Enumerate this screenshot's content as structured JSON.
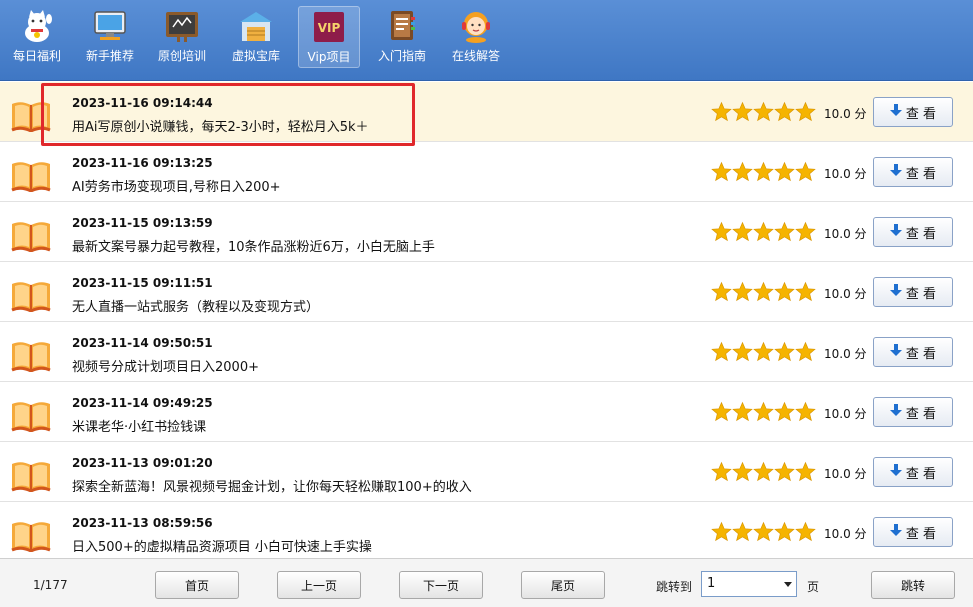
{
  "toolbar": {
    "items": [
      {
        "label": "每日福利",
        "icon": "lucky-cat-icon"
      },
      {
        "label": "新手推荐",
        "icon": "computer-icon"
      },
      {
        "label": "原创培训",
        "icon": "chalkboard-icon"
      },
      {
        "label": "虚拟宝库",
        "icon": "warehouse-icon"
      },
      {
        "label": "Vip项目",
        "icon": "vip-icon",
        "badge": "VIP",
        "active": true
      },
      {
        "label": "入门指南",
        "icon": "book-stack-icon"
      },
      {
        "label": "在线解答",
        "icon": "support-agent-icon"
      }
    ]
  },
  "list": {
    "score_unit": "分",
    "view_label": "查 看",
    "items": [
      {
        "date": "2023-11-16 09:14:44",
        "title": "用Ai写原创小说赚钱，每天2-3小时，轻松月入5k＋",
        "score": "10.0",
        "stars": 5
      },
      {
        "date": "2023-11-16 09:13:25",
        "title": "AI劳务市场变现项目,号称日入200+",
        "score": "10.0",
        "stars": 5
      },
      {
        "date": "2023-11-15 09:13:59",
        "title": "最新文案号暴力起号教程，10条作品涨粉近6万，小白无脑上手",
        "score": "10.0",
        "stars": 5
      },
      {
        "date": "2023-11-15 09:11:51",
        "title": "无人直播一站式服务（教程以及变现方式）",
        "score": "10.0",
        "stars": 5
      },
      {
        "date": "2023-11-14 09:50:51",
        "title": "视频号分成计划项目日入2000+",
        "score": "10.0",
        "stars": 5
      },
      {
        "date": "2023-11-14 09:49:25",
        "title": "米课老华·小红书捡钱课",
        "score": "10.0",
        "stars": 5
      },
      {
        "date": "2023-11-13 09:01:20",
        "title": "探索全新蓝海！风景视频号掘金计划，让你每天轻松赚取100+的收入",
        "score": "10.0",
        "stars": 5
      },
      {
        "date": "2023-11-13 08:59:56",
        "title": "日入500+的虚拟精品资源项目 小白可快速上手实操",
        "score": "10.0",
        "stars": 5
      }
    ]
  },
  "footer": {
    "page_info": "1/177",
    "first_label": "首页",
    "prev_label": "上一页",
    "next_label": "下一页",
    "last_label": "尾页",
    "jump_label": "跳转到",
    "page_value": "1",
    "page_unit": "页",
    "go_label": "跳转"
  },
  "colors": {
    "toolbar": "#4a82cc",
    "highlight_row": "#fdf6df",
    "highlight_border": "#e0282b",
    "star": "#f5b400"
  }
}
